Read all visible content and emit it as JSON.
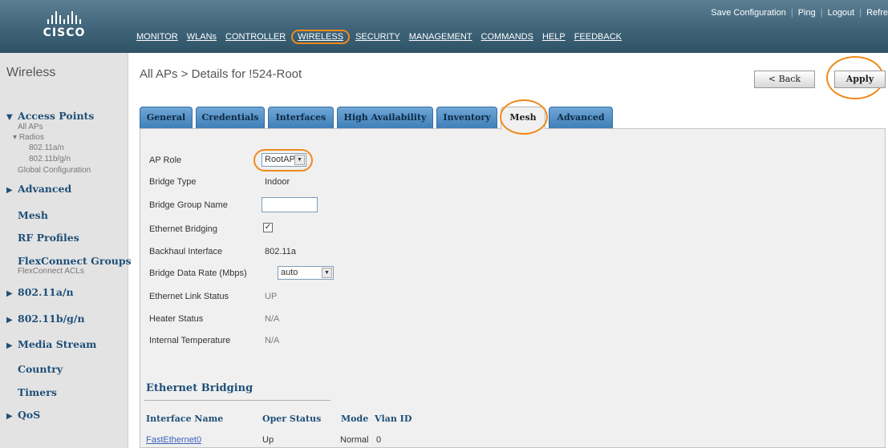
{
  "brand": {
    "logo_text": "CISCO"
  },
  "nav": [
    "MONITOR",
    "WLANs",
    "CONTROLLER",
    "WIRELESS",
    "SECURITY",
    "MANAGEMENT",
    "COMMANDS",
    "HELP",
    "FEEDBACK"
  ],
  "nav_active": "WIRELESS",
  "util_links": [
    "Save Configuration",
    "Ping",
    "Logout",
    "Refre"
  ],
  "sidebar": {
    "title": "Wireless",
    "access_points": "Access Points",
    "all_aps": "All APs",
    "radios": "Radios",
    "radio_a": "802.11a/n",
    "radio_b": "802.11b/g/n",
    "global_config": "Global Configuration",
    "advanced": "Advanced",
    "mesh": "Mesh",
    "rf_profiles": "RF Profiles",
    "flexconnect_groups": "FlexConnect Groups",
    "flexconnect_acls": "FlexConnect ACLs",
    "dot11a": "802.11a/n",
    "dot11b": "802.11b/g/n",
    "media_stream": "Media Stream",
    "country": "Country",
    "timers": "Timers",
    "qos": "QoS"
  },
  "breadcrumb": "All APs > Details for !524-Root",
  "buttons": {
    "back": "< Back",
    "apply": "Apply"
  },
  "tabs": [
    "General",
    "Credentials",
    "Interfaces",
    "High Availability",
    "Inventory",
    "Mesh",
    "Advanced"
  ],
  "active_tab": "Mesh",
  "form": {
    "ap_role_label": "AP Role",
    "ap_role_value": "RootAP",
    "bridge_type_label": "Bridge Type",
    "bridge_type_value": "Indoor",
    "bridge_group_label": "Bridge Group Name",
    "bridge_group_value": "",
    "ethernet_bridging_label": "Ethernet Bridging",
    "ethernet_bridging_checked": "✓",
    "backhaul_label": "Backhaul Interface",
    "backhaul_value": "802.11a",
    "data_rate_label": "Bridge Data Rate (Mbps)",
    "data_rate_value": "auto",
    "link_status_label": "Ethernet Link Status",
    "link_status_value": "UP",
    "heater_label": "Heater Status",
    "heater_value": "N/A",
    "temp_label": "Internal Temperature",
    "temp_value": "N/A"
  },
  "eth_bridging": {
    "title": "Ethernet Bridging",
    "headers": [
      "Interface Name",
      "Oper Status",
      "Mode",
      "Vlan ID"
    ],
    "rows": [
      [
        "FastEthernet0",
        "Up",
        "Normal",
        "0"
      ]
    ]
  },
  "accent": "#f08a1c"
}
